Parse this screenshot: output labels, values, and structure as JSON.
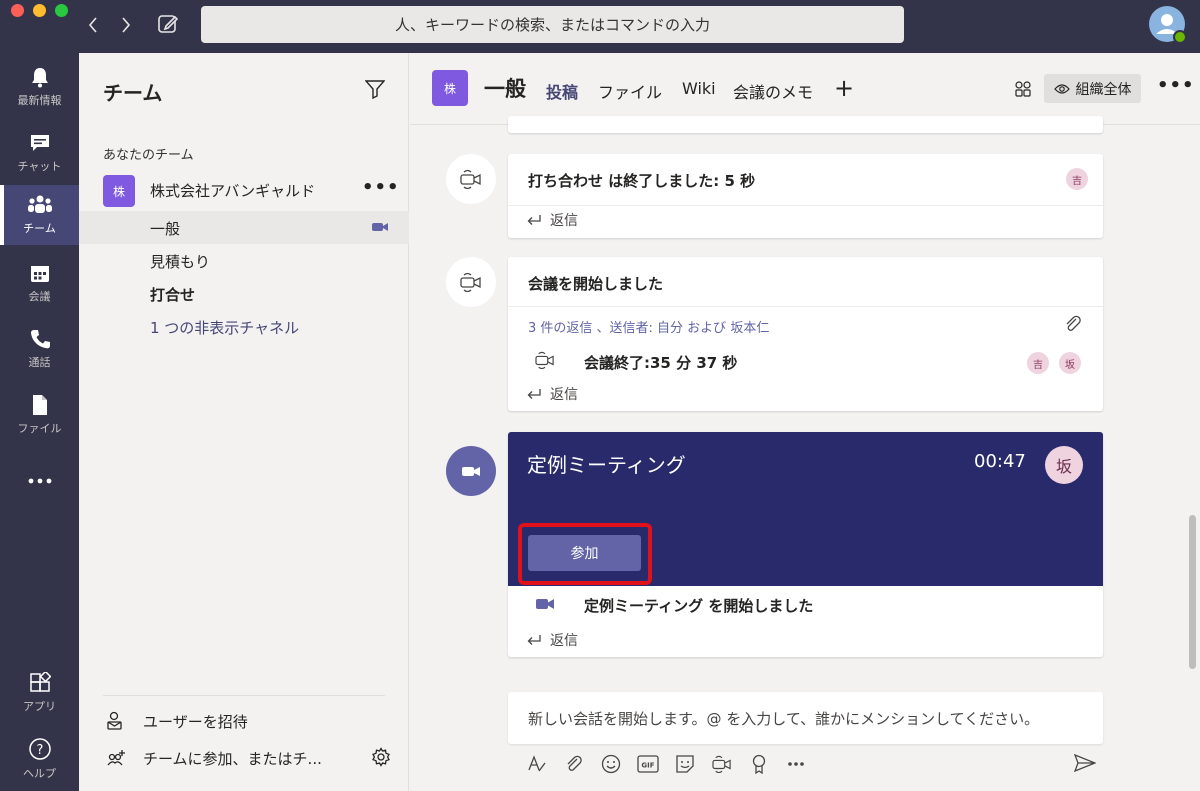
{
  "search": {
    "placeholder": "人、キーワードの検索、またはコマンドの入力"
  },
  "rail": [
    {
      "id": "activity",
      "label": "最新情報",
      "icon": "bell-icon"
    },
    {
      "id": "chat",
      "label": "チャット",
      "icon": "chat-icon"
    },
    {
      "id": "teams",
      "label": "チーム",
      "icon": "teams-icon",
      "active": true
    },
    {
      "id": "calendar",
      "label": "会議",
      "icon": "calendar-icon"
    },
    {
      "id": "calls",
      "label": "通話",
      "icon": "phone-icon"
    },
    {
      "id": "files",
      "label": "ファイル",
      "icon": "file-icon"
    },
    {
      "id": "apps",
      "label": "アプリ",
      "icon": "apps-icon"
    },
    {
      "id": "help",
      "label": "ヘルプ",
      "icon": "help-icon"
    }
  ],
  "teams_panel": {
    "title": "チーム",
    "section_label": "あなたのチーム",
    "team": {
      "avatar": "株",
      "name": "株式会社アバンギャルド"
    },
    "channels": [
      {
        "name": "一般",
        "active": true,
        "meeting": true
      },
      {
        "name": "見積もり"
      },
      {
        "name": "打合せ",
        "bold": true
      },
      {
        "name": "1 つの非表示チャネル",
        "hidden": true
      }
    ],
    "invite_label": "ユーザーを招待",
    "join_label": "チームに参加、またはチ..."
  },
  "channel_header": {
    "avatar": "株",
    "title": "一般",
    "tabs": [
      "投稿",
      "ファイル",
      "Wiki",
      "会議のメモ"
    ],
    "active_tab": "投稿",
    "org_button": "組織全体"
  },
  "posts": [
    {
      "title": "打ち合わせ は終了しました: 5 秒",
      "avatars": [
        "吉"
      ],
      "reply": "返信"
    },
    {
      "title": "会議を開始しました",
      "thread_summary": "3 件の返信 、送信者: 自分 および 坂本仁",
      "sub_message": "会議終了:35 分 37 秒",
      "avatars": [
        "吉",
        "坂"
      ],
      "reply": "返信"
    },
    {
      "meeting_title": "定例ミーティング",
      "timer": "00:47",
      "avatar": "坂",
      "join_label": "参加",
      "status_text": "定例ミーティング を開始しました",
      "reply": "返信"
    }
  ],
  "compose": {
    "placeholder": "新しい会話を開始します。@ を入力して、誰かにメンションしてください。"
  },
  "colors": {
    "rail_bg": "#33344a",
    "accent": "#6264a7",
    "meeting_banner": "#292a6b",
    "highlight": "#e0111b"
  }
}
